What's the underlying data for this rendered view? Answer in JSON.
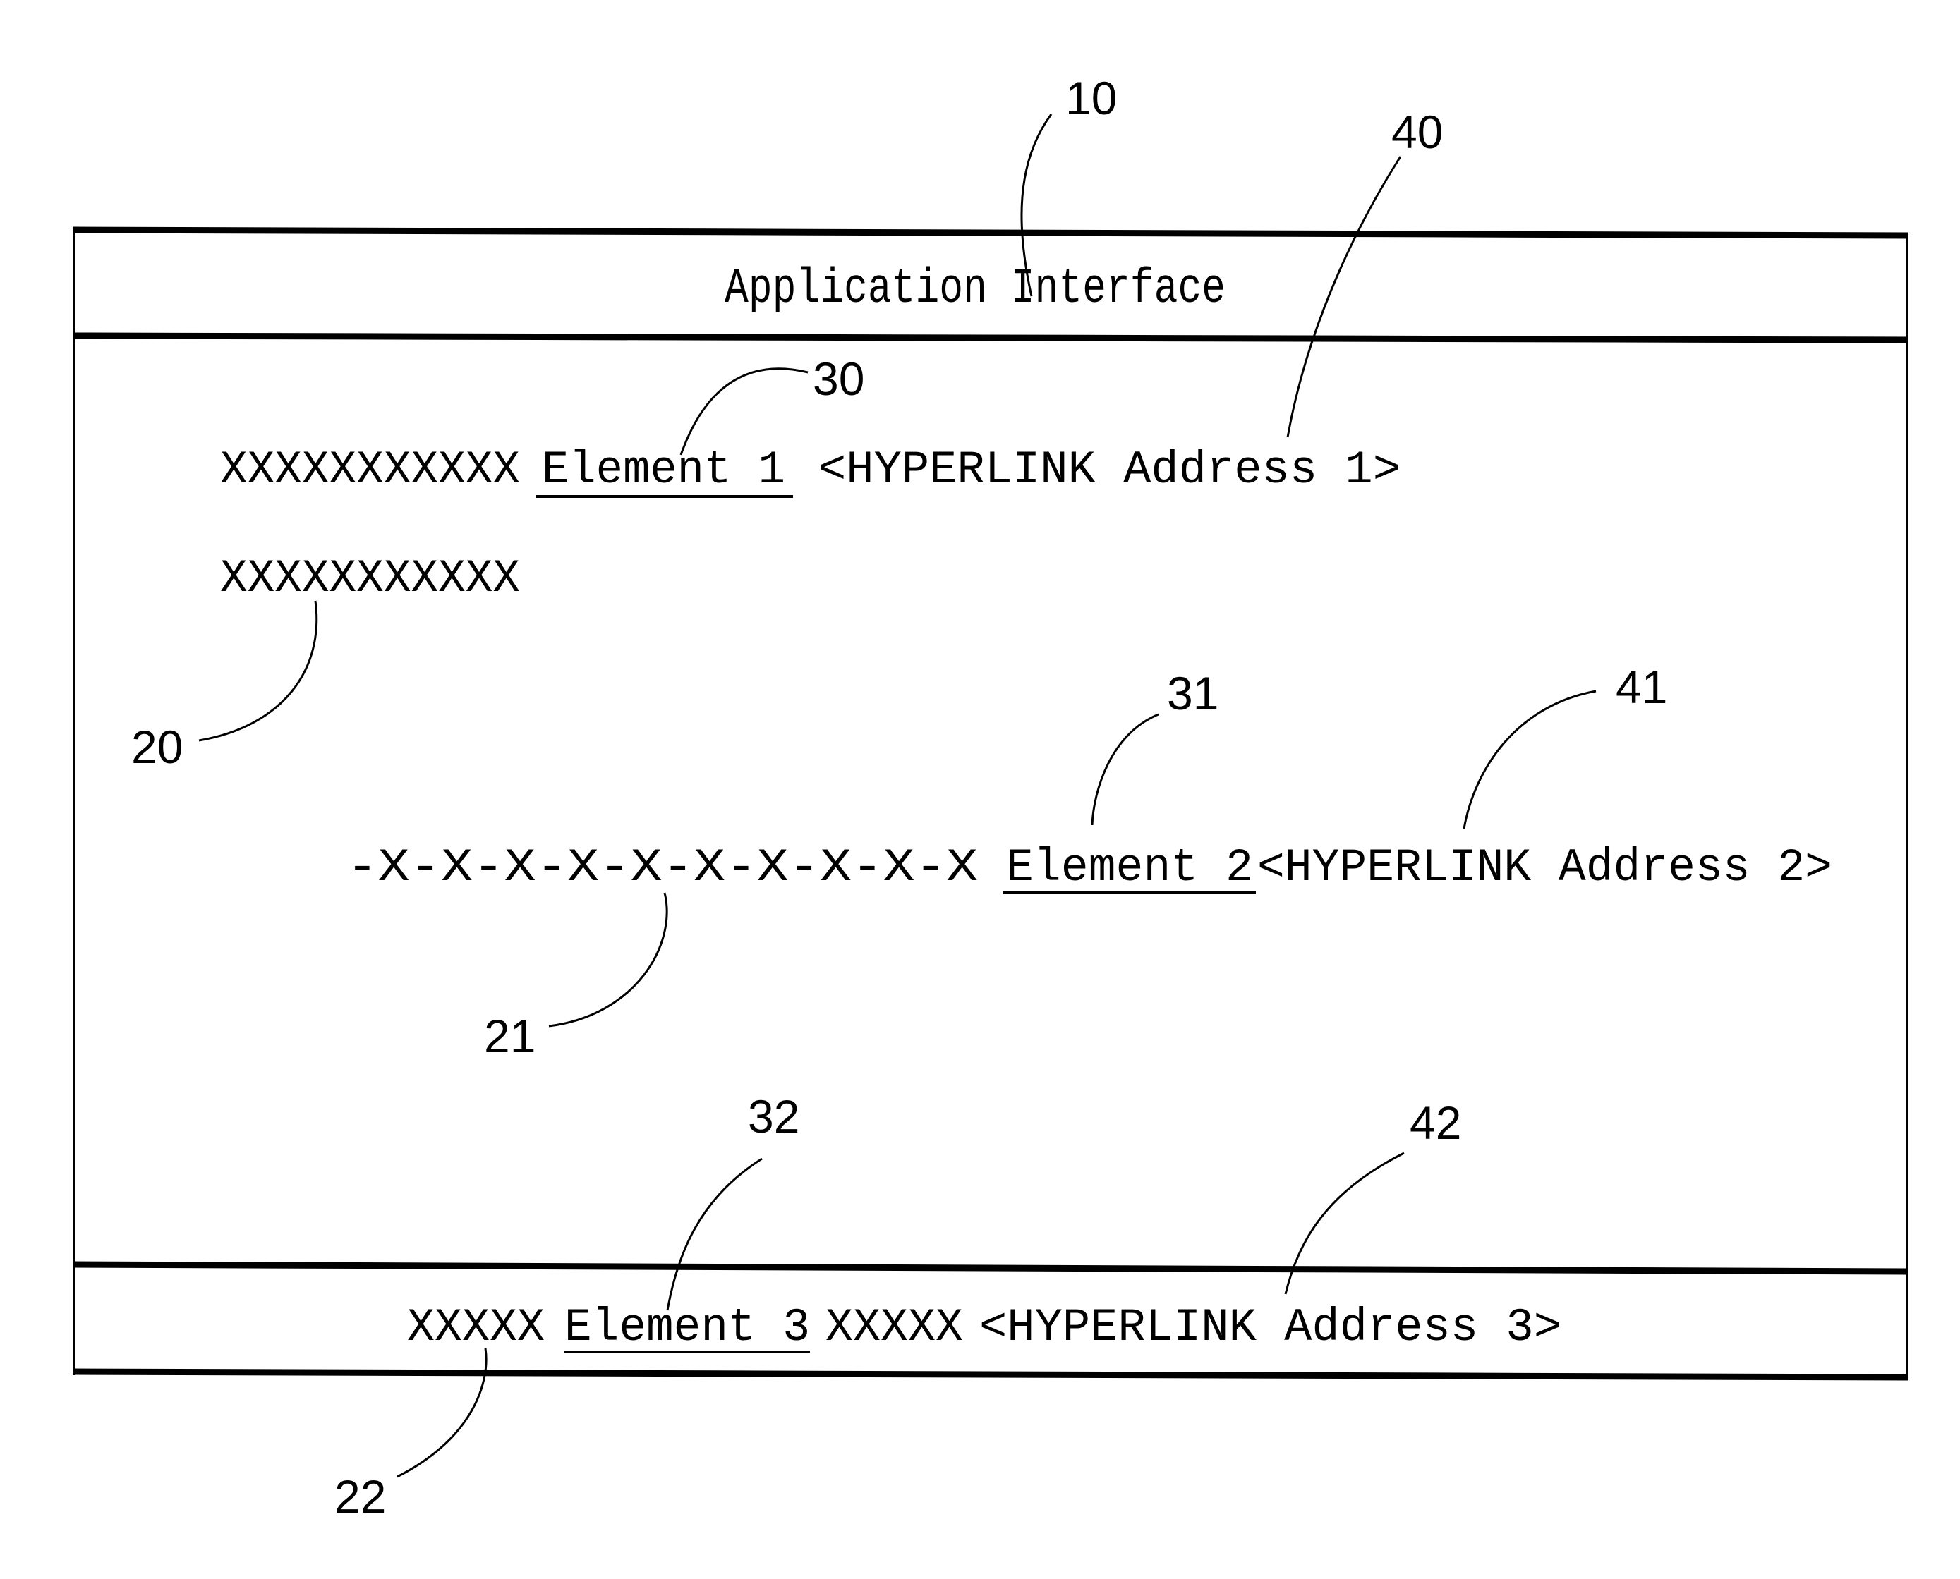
{
  "figure": {
    "title": "Application Interface",
    "reference_labels": {
      "interface": "10",
      "text_1": "20",
      "text_2": "21",
      "text_3": "22",
      "element_1": "30",
      "element_2": "31",
      "element_3": "32",
      "hyperlink_1": "40",
      "hyperlink_2": "41",
      "hyperlink_3": "42"
    },
    "rows": [
      {
        "text": "XXXXXXXXXXX",
        "element": "Element 1",
        "hyperlink": "<HYPERLINK Address 1>"
      },
      {
        "text": "XXXXXXXXXXX"
      },
      {
        "text": "-X-X-X-X-X-X-X-X-X-X",
        "element": "Element 2",
        "hyperlink": "<HYPERLINK Address 2>"
      }
    ],
    "footer": {
      "text_before": "XXXXX",
      "element": "Element 3",
      "text_after": "XXXXX",
      "hyperlink": "<HYPERLINK Address 3>"
    }
  }
}
